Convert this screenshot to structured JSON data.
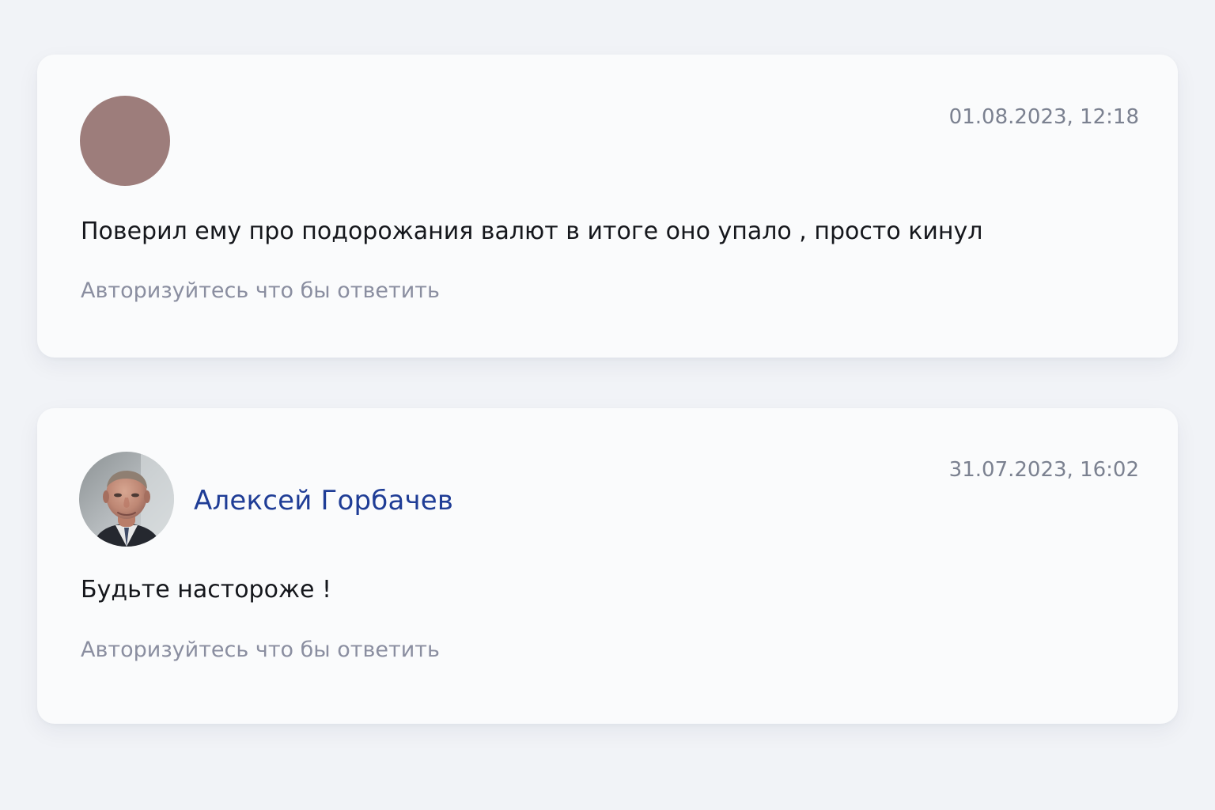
{
  "comments": [
    {
      "author": "",
      "avatar_color": "#9d7d7b",
      "timestamp": "01.08.2023, 12:18",
      "text": "Поверил ему про подорожания валют в итоге оно упало , просто кинул",
      "reply_prompt": "Авторизуйтесь что бы ответить"
    },
    {
      "author": "Алексей Горбачев",
      "avatar_icon": "person-photo-icon",
      "timestamp": "31.07.2023, 16:02",
      "text": "Будьте настороже !",
      "reply_prompt": "Авторизуйтесь что бы ответить"
    }
  ],
  "colors": {
    "background": "#f1f3f7",
    "card": "#fafbfc",
    "author_link": "#1f3d96",
    "timestamp": "#7b8190",
    "message": "#15171c",
    "reply_prompt": "#8a8ea0"
  }
}
